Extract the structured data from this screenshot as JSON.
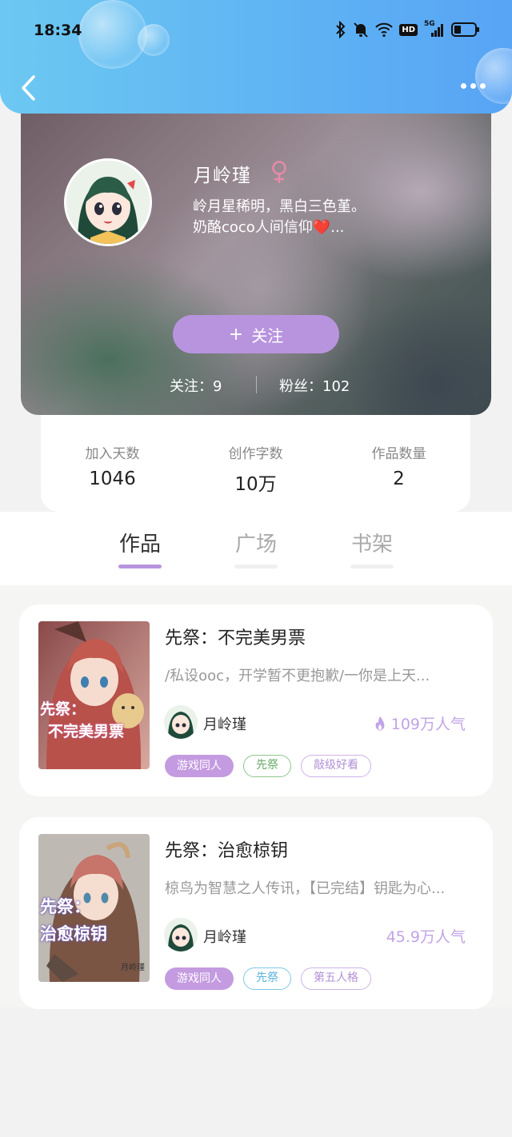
{
  "status_bar": {
    "time": "18:34",
    "network": "5G",
    "hd": "HD"
  },
  "profile": {
    "name": "月岭瑾",
    "gender_icon": "female-icon",
    "bio_line1": "岭月星稀明，黑白三色堇。",
    "bio_line2": "奶酪coco人间信仰❤️...",
    "follow_plus": "+",
    "follow_label": "关注",
    "following": "关注：9",
    "fans": "粉丝：102"
  },
  "stats": [
    {
      "label": "加入天数",
      "value": "1046"
    },
    {
      "label": "创作字数",
      "value": "10万"
    },
    {
      "label": "作品数量",
      "value": "2"
    }
  ],
  "tabs": [
    {
      "label": "作品",
      "active": true
    },
    {
      "label": "广场",
      "active": false
    },
    {
      "label": "书架",
      "active": false
    }
  ],
  "works": [
    {
      "title": "先祭：不完美男票",
      "desc": "/私设ooc，开学暂不更抱歉/一你是上天...",
      "author": "月岭瑾",
      "popularity": "109万人气",
      "cover_text_line1": "先祭：",
      "cover_text_line2": "不完美男票",
      "tags": [
        "游戏同人",
        "先祭",
        "敲级好看"
      ]
    },
    {
      "title": "先祭：治愈椋钥",
      "desc": "椋鸟为智慧之人传讯，【已完结】钥匙为心...",
      "author": "月岭瑾",
      "popularity": "45.9万人气",
      "cover_text_line1": "先祭：",
      "cover_text_line2": "治愈椋钥",
      "cover_subtext": "月岭瑾",
      "tags": [
        "游戏同人",
        "先祭",
        "第五人格"
      ]
    }
  ],
  "colors": {
    "accent": "#b894df",
    "topbar": "#5fb4f3"
  }
}
